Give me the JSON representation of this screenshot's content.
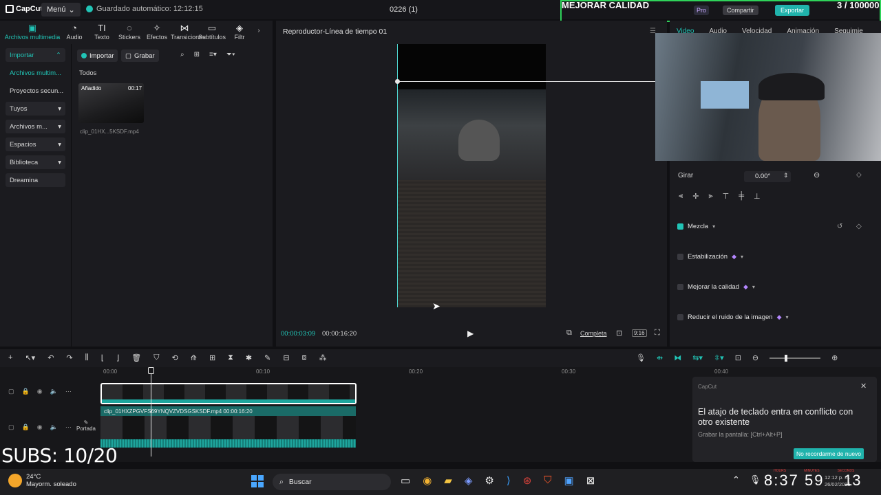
{
  "titlebar": {
    "logo": "CapCut",
    "menu": "Menú",
    "autosave": "Guardado automático: 12:12:15",
    "project": "0226 (1)",
    "banner": "MEJORAR CALIDAD",
    "counter": "3 / 100000",
    "pro": "Pro",
    "share": "Compartir",
    "export": "Exportar"
  },
  "media_toolbar": [
    {
      "label": "Archivos multimedia",
      "icon": "▣"
    },
    {
      "label": "Audio",
      "icon": "◔"
    },
    {
      "label": "Texto",
      "icon": "TI"
    },
    {
      "label": "Stickers",
      "icon": "◌"
    },
    {
      "label": "Efectos",
      "icon": "✧"
    },
    {
      "label": "Transiciones",
      "icon": "⋈"
    },
    {
      "label": "Subtítulos",
      "icon": "▭"
    },
    {
      "label": "Filtr",
      "icon": "◈"
    }
  ],
  "nav": [
    {
      "label": "Importar",
      "arrow": "⌃"
    },
    {
      "label": "Archivos multim...",
      "arrow": ""
    },
    {
      "label": "Proyectos secun...",
      "arrow": ""
    },
    {
      "label": "Tuyos",
      "arrow": "▾"
    },
    {
      "label": "Archivos m...",
      "arrow": "▾"
    },
    {
      "label": "Espacios",
      "arrow": "▾"
    },
    {
      "label": "Biblioteca",
      "arrow": "▾"
    },
    {
      "label": "Dreamina",
      "arrow": ""
    }
  ],
  "media": {
    "import": "Importar",
    "record": "Grabar",
    "all": "Todos",
    "thumb_badge": "Añadido",
    "thumb_duration": "00:17",
    "thumb_name": "clip_01HX...5KSDF.mp4"
  },
  "player": {
    "title": "Reproductor-Línea de tiempo 01",
    "current": "00:00:03:09",
    "total": "00:00:16:20",
    "full": "Completa",
    "ratio": "9:16"
  },
  "right": {
    "tabs": [
      "Video",
      "Audio",
      "Velocidad",
      "Animación",
      "Seguimie"
    ],
    "rotate_label": "Girar",
    "rotate_value": "0.00°",
    "settings": [
      {
        "label": "Mezcla",
        "on": true,
        "gem": false
      },
      {
        "label": "Estabilización",
        "on": false,
        "gem": true
      },
      {
        "label": "Mejorar la calidad",
        "on": false,
        "gem": true
      },
      {
        "label": "Reducir el ruido de la imagen",
        "on": false,
        "gem": true
      }
    ]
  },
  "timeline": {
    "ruler": [
      "00:00",
      "00:10",
      "00:20",
      "00:30",
      "00:40"
    ],
    "clip_name": "clip_01HXZPGVFS69YNQVZVDSGSKSDF.mp4   00:00:16:20",
    "cover": "Portada",
    "subs": "SUBS: 10/20"
  },
  "toast": {
    "brand": "CapCut",
    "title": "El atajo de teclado entra en conflicto con otro existente",
    "sub": "Grabar la pantalla: [Ctrl+Alt+P]",
    "button": "No recordarme de nuevo"
  },
  "taskbar": {
    "temp": "24°C",
    "weather": "Mayorm. soleado",
    "search": "Buscar",
    "clock": "8:37",
    "clock_mid": "59",
    "clock_sec": "13",
    "clock_labels": [
      "HOURS",
      "MINUTES",
      "SECONDS"
    ],
    "time_small": "12:12 p. m.",
    "date_small": "26/02/2025"
  },
  "colors": {
    "accent": "#21c4b6",
    "banner_border": "#2fd35a",
    "pro": "#b487ff"
  }
}
